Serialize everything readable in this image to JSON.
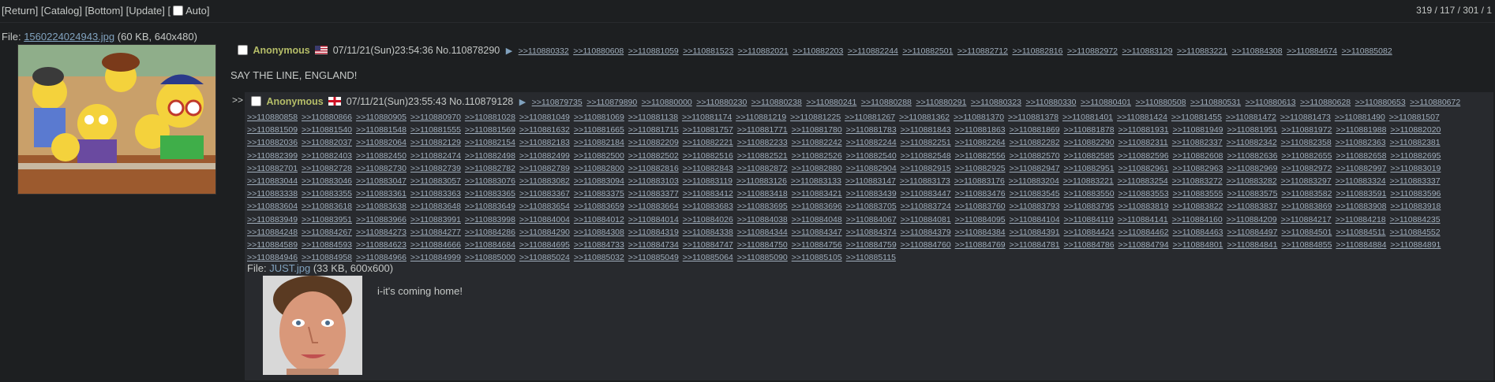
{
  "nav": {
    "return": "Return",
    "catalog": "Catalog",
    "bottom": "Bottom",
    "update": "Update",
    "auto": "Auto",
    "stats": "319 / 117 / 301 / 1"
  },
  "op": {
    "file_label": "File:",
    "file_name": "1560224024943.jpg",
    "file_meta": "(60 KB, 640x480)",
    "name": "Anonymous",
    "datetime": "07/11/21(Sun)23:54:36",
    "number": "No.110878290",
    "text": "SAY THE LINE, ENGLAND!",
    "backlinks": [
      ">>110880332",
      ">>110880608",
      ">>110881059",
      ">>110881523",
      ">>110882021",
      ">>110882203",
      ">>110882244",
      ">>110882501",
      ">>110882712",
      ">>110882816",
      ">>110882972",
      ">>110883129",
      ">>110883221",
      ">>110884308",
      ">>110884674",
      ">>110885082"
    ]
  },
  "reply": {
    "side": ">>",
    "name": "Anonymous",
    "datetime": "07/11/21(Sun)23:55:43",
    "number": "No.110879128",
    "head_backlinks": [
      ">>110879735",
      ">>110879890",
      ">>110880000",
      ">>110880230",
      ">>110880238",
      ">>110880241",
      ">>110880288",
      ">>110880291",
      ">>110880323",
      ">>110880330",
      ">>110880401",
      ">>110880508",
      ">>110880531",
      ">>110880613",
      ">>110880628",
      ">>110880653",
      ">>110880672"
    ],
    "backlinks": [
      ">>110880858",
      ">>110880866",
      ">>110880905",
      ">>110880970",
      ">>110881028",
      ">>110881049",
      ">>110881069",
      ">>110881138",
      ">>110881174",
      ">>110881219",
      ">>110881225",
      ">>110881267",
      ">>110881362",
      ">>110881370",
      ">>110881378",
      ">>110881401",
      ">>110881424",
      ">>110881455",
      ">>110881472",
      ">>110881473",
      ">>110881490",
      ">>110881507",
      ">>110881509",
      ">>110881540",
      ">>110881548",
      ">>110881555",
      ">>110881569",
      ">>110881632",
      ">>110881665",
      ">>110881715",
      ">>110881757",
      ">>110881771",
      ">>110881780",
      ">>110881783",
      ">>110881843",
      ">>110881863",
      ">>110881869",
      ">>110881878",
      ">>110881931",
      ">>110881949",
      ">>110881951",
      ">>110881972",
      ">>110881988",
      ">>110882020",
      ">>110882036",
      ">>110882037",
      ">>110882064",
      ">>110882129",
      ">>110882154",
      ">>110882183",
      ">>110882184",
      ">>110882209",
      ">>110882221",
      ">>110882233",
      ">>110882242",
      ">>110882244",
      ">>110882251",
      ">>110882264",
      ">>110882282",
      ">>110882290",
      ">>110882311",
      ">>110882337",
      ">>110882342",
      ">>110882358",
      ">>110882363",
      ">>110882381",
      ">>110882399",
      ">>110882403",
      ">>110882450",
      ">>110882474",
      ">>110882498",
      ">>110882499",
      ">>110882500",
      ">>110882502",
      ">>110882516",
      ">>110882521",
      ">>110882526",
      ">>110882540",
      ">>110882548",
      ">>110882556",
      ">>110882570",
      ">>110882585",
      ">>110882596",
      ">>110882608",
      ">>110882636",
      ">>110882655",
      ">>110882658",
      ">>110882695",
      ">>110882701",
      ">>110882728",
      ">>110882730",
      ">>110882739",
      ">>110882782",
      ">>110882789",
      ">>110882800",
      ">>110882816",
      ">>110882843",
      ">>110882872",
      ">>110882880",
      ">>110882904",
      ">>110882915",
      ">>110882925",
      ">>110882947",
      ">>110882951",
      ">>110882961",
      ">>110882963",
      ">>110882969",
      ">>110882972",
      ">>110882997",
      ">>110883019",
      ">>110883044",
      ">>110883046",
      ">>110883047",
      ">>110883057",
      ">>110883076",
      ">>110883082",
      ">>110883094",
      ">>110883103",
      ">>110883119",
      ">>110883126",
      ">>110883133",
      ">>110883147",
      ">>110883173",
      ">>110883176",
      ">>110883204",
      ">>110883221",
      ">>110883254",
      ">>110883272",
      ">>110883282",
      ">>110883297",
      ">>110883324",
      ">>110883337",
      ">>110883338",
      ">>110883355",
      ">>110883361",
      ">>110883363",
      ">>110883365",
      ">>110883367",
      ">>110883375",
      ">>110883377",
      ">>110883412",
      ">>110883418",
      ">>110883421",
      ">>110883439",
      ">>110883447",
      ">>110883476",
      ">>110883545",
      ">>110883550",
      ">>110883553",
      ">>110883555",
      ">>110883575",
      ">>110883582",
      ">>110883591",
      ">>110883596",
      ">>110883604",
      ">>110883618",
      ">>110883638",
      ">>110883648",
      ">>110883649",
      ">>110883654",
      ">>110883659",
      ">>110883664",
      ">>110883683",
      ">>110883695",
      ">>110883696",
      ">>110883705",
      ">>110883724",
      ">>110883760",
      ">>110883793",
      ">>110883795",
      ">>110883819",
      ">>110883822",
      ">>110883837",
      ">>110883869",
      ">>110883908",
      ">>110883918",
      ">>110883949",
      ">>110883951",
      ">>110883966",
      ">>110883991",
      ">>110883998",
      ">>110884004",
      ">>110884012",
      ">>110884014",
      ">>110884026",
      ">>110884038",
      ">>110884048",
      ">>110884067",
      ">>110884081",
      ">>110884095",
      ">>110884104",
      ">>110884119",
      ">>110884141",
      ">>110884160",
      ">>110884209",
      ">>110884217",
      ">>110884218",
      ">>110884235",
      ">>110884248",
      ">>110884267",
      ">>110884273",
      ">>110884277",
      ">>110884286",
      ">>110884290",
      ">>110884308",
      ">>110884319",
      ">>110884338",
      ">>110884344",
      ">>110884347",
      ">>110884374",
      ">>110884379",
      ">>110884384",
      ">>110884391",
      ">>110884424",
      ">>110884462",
      ">>110884463",
      ">>110884497",
      ">>110884501",
      ">>110884511",
      ">>110884552",
      ">>110884589",
      ">>110884593",
      ">>110884623",
      ">>110884666",
      ">>110884684",
      ">>110884695",
      ">>110884733",
      ">>110884734",
      ">>110884747",
      ">>110884750",
      ">>110884756",
      ">>110884759",
      ">>110884760",
      ">>110884769",
      ">>110884781",
      ">>110884786",
      ">>110884794",
      ">>110884801",
      ">>110884841",
      ">>110884855",
      ">>110884884",
      ">>110884891",
      ">>110884946",
      ">>110884958",
      ">>110884966",
      ">>110884999",
      ">>110885000",
      ">>110885024",
      ">>110885032",
      ">>110885049",
      ">>110885064",
      ">>110885090",
      ">>110885105",
      ">>110885115"
    ],
    "file_label": "File:",
    "file_name": "JUST.jpg",
    "file_meta": "(33 KB, 600x600)",
    "text": "i-it's coming home!"
  }
}
